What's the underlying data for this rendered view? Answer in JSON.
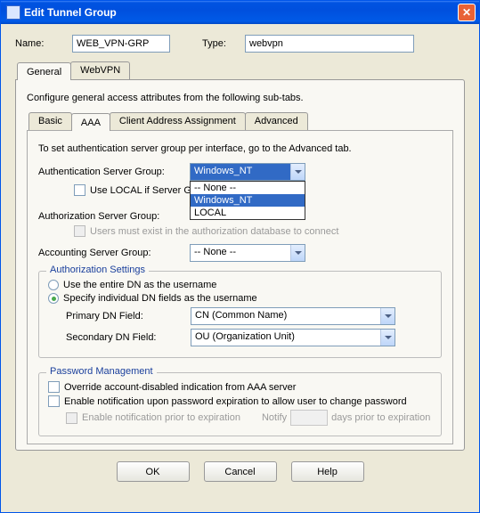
{
  "window": {
    "title": "Edit Tunnel Group"
  },
  "header": {
    "name_label": "Name:",
    "name_value": "WEB_VPN-GRP",
    "type_label": "Type:",
    "type_value": "webvpn"
  },
  "tabs": {
    "general": "General",
    "webvpn": "WebVPN"
  },
  "general": {
    "instruction": "Configure general access attributes from the following sub-tabs.",
    "subtabs": {
      "basic": "Basic",
      "aaa": "AAA",
      "client_addr": "Client Address Assignment",
      "advanced": "Advanced"
    },
    "aaa": {
      "note": "To set authentication server group per interface, go to the Advanced tab.",
      "authn_label": "Authentication Server Group:",
      "authn_value": "Windows_NT",
      "authn_options": [
        "-- None --",
        "Windows_NT",
        "LOCAL"
      ],
      "use_local_label": "Use LOCAL if Server Gro",
      "authz_label": "Authorization Server Group:",
      "authz_users_label": "Users must exist in the authorization database to connect",
      "acct_label": "Accounting Server Group:",
      "acct_value": "-- None --",
      "authz_settings": {
        "legend": "Authorization Settings",
        "radio_entire_dn": "Use the entire DN as the username",
        "radio_specify": "Specify individual DN fields as the username",
        "primary_label": "Primary DN Field:",
        "primary_value": "CN (Common Name)",
        "secondary_label": "Secondary DN Field:",
        "secondary_value": "OU (Organization Unit)"
      },
      "pw_mgmt": {
        "legend": "Password Management",
        "override_label": "Override account-disabled indication from AAA server",
        "enable_notif_label": "Enable notification upon password expiration to allow user to change password",
        "prior_label": "Enable notification prior to expiration",
        "notify_label": "Notify",
        "days_label": "days prior to expiration"
      }
    }
  },
  "buttons": {
    "ok": "OK",
    "cancel": "Cancel",
    "help": "Help"
  }
}
